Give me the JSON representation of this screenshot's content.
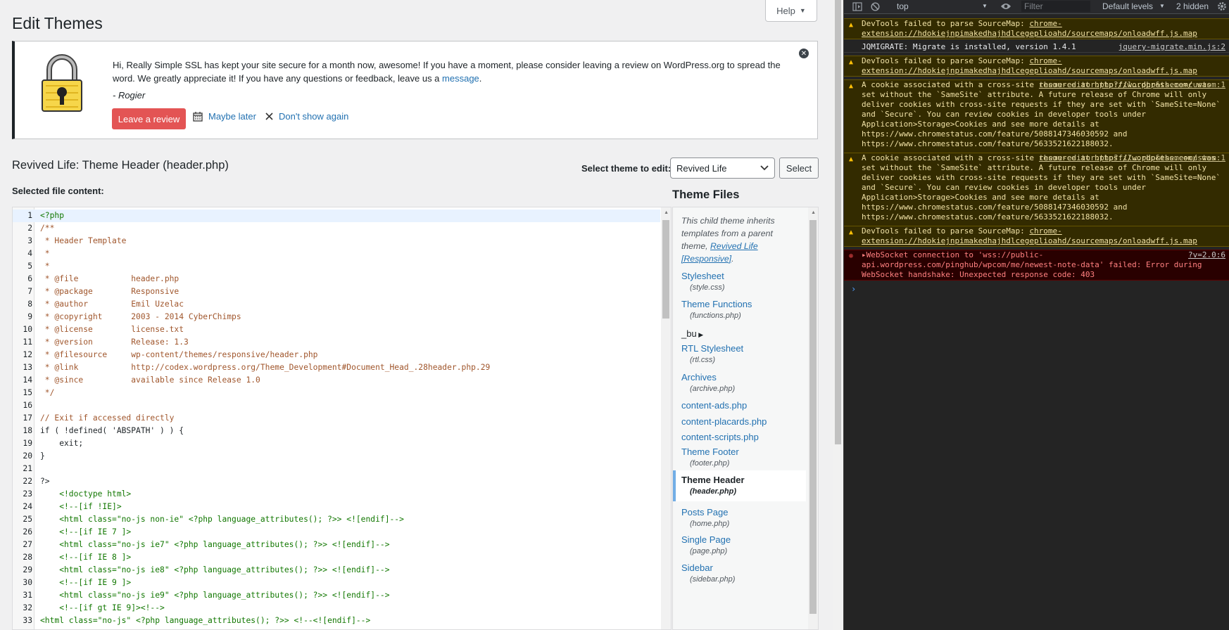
{
  "wp": {
    "help_label": "Help",
    "page_title": "Edit Themes",
    "notice": {
      "text_before": "Hi, Really Simple SSL has kept your site secure for a month now, awesome! If you have a moment, please consider leaving a review on WordPress.org to spread the word. We greatly appreciate it! If you have any questions or feedback, leave us a ",
      "link_message": "message",
      "text_after": ".",
      "signature": "- Rogier",
      "review_button": "Leave a review",
      "maybe_later": "Maybe later",
      "dont_show": "Don't show again"
    },
    "file_title": "Revived Life: Theme Header (header.php)",
    "select_label": "Select theme to edit:",
    "select_value": "Revived Life",
    "select_button": "Select",
    "content_label": "Selected file content:",
    "files_title": "Theme Files",
    "files_note_before": "This child theme inherits templates from a parent theme, ",
    "files_note_link": "Revived Life [Responsive]",
    "files_note_after": "."
  },
  "code_lines": [
    "<?php",
    "/**",
    " * Header Template",
    " *",
    " *",
    " * @file           header.php",
    " * @package        Responsive",
    " * @author         Emil Uzelac",
    " * @copyright      2003 - 2014 CyberChimps",
    " * @license        license.txt",
    " * @version        Release: 1.3",
    " * @filesource     wp-content/themes/responsive/header.php",
    " * @link           http://codex.wordpress.org/Theme_Development#Document_Head_.28header.php.29",
    " * @since          available since Release 1.0",
    " */",
    "",
    "// Exit if accessed directly",
    "if ( !defined( 'ABSPATH' ) ) {",
    "    exit;",
    "}",
    "",
    "?>",
    "    <!doctype html>",
    "    <!--[if !IE]>",
    "    <html class=\"no-js non-ie\" <?php language_attributes(); ?>> <![endif]-->",
    "    <!--[if IE 7 ]>",
    "    <html class=\"no-js ie7\" <?php language_attributes(); ?>> <![endif]-->",
    "    <!--[if IE 8 ]>",
    "    <html class=\"no-js ie8\" <?php language_attributes(); ?>> <![endif]-->",
    "    <!--[if IE 9 ]>",
    "    <html class=\"no-js ie9\" <?php language_attributes(); ?>> <![endif]-->",
    "    <!--[if gt IE 9]><!-->",
    "<html class=\"no-js\" <?php language_attributes(); ?>> <!--<![endif]-->"
  ],
  "files": [
    {
      "label": "Stylesheet",
      "sub": "(style.css)"
    },
    {
      "label": "Theme Functions",
      "sub": "(functions.php)"
    },
    {
      "label": "_bu",
      "folder": true
    },
    {
      "label": "RTL Stylesheet",
      "sub": "(rtl.css)"
    },
    {
      "label": "Archives",
      "sub": "(archive.php)"
    },
    {
      "label": "content-ads.php"
    },
    {
      "label": "content-placards.php"
    },
    {
      "label": "content-scripts.php"
    },
    {
      "label": "Theme Footer",
      "sub": "(footer.php)"
    },
    {
      "label": "Theme Header",
      "sub": "(header.php)",
      "active": true
    },
    {
      "label": "Posts Page",
      "sub": "(home.php)"
    },
    {
      "label": "Single Page",
      "sub": "(page.php)"
    },
    {
      "label": "Sidebar",
      "sub": "(sidebar.php)"
    }
  ],
  "devtools": {
    "context": "top",
    "filter_placeholder": "Filter",
    "levels": "Default levels",
    "hidden": "2 hidden",
    "messages": [
      {
        "level": "warn",
        "text": "DevTools failed to parse SourceMap: ",
        "link": "chrome-extension://hdokiejnpimakedhajhdlcegeplioahd/sourcemaps/onloadwff.js.map"
      },
      {
        "level": "info",
        "text": "JQMIGRATE: Migrate is installed, version 1.4.1",
        "source": "jquery-migrate.min.js:2"
      },
      {
        "level": "warn",
        "text": "DevTools failed to parse SourceMap: ",
        "link": "chrome-extension://hdokiejnpimakedhajhdlcegeplioahd/sourcemaps/onloadwff.js.map"
      },
      {
        "level": "warn",
        "text": "A cookie associated with a cross-site resource at http://wordpress.com/ was set without the `SameSite` attribute. A future release of Chrome will only deliver cookies with cross-site requests if they are set with `SameSite=None` and `Secure`. You can review cookies in developer tools under Application>Storage>Cookies and see more details at https://www.chromestatus.com/feature/5088147346030592 and https://www.chromestatus.com/feature/5633521622188032.",
        "source": "theme-editor.php?fil….php&theme=custom:1"
      },
      {
        "level": "warn",
        "text": "A cookie associated with a cross-site resource at https://wordpress.com/ was set without the `SameSite` attribute. A future release of Chrome will only deliver cookies with cross-site requests if they are set with `SameSite=None` and `Secure`. You can review cookies in developer tools under Application>Storage>Cookies and see more details at https://www.chromestatus.com/feature/5088147346030592 and https://www.chromestatus.com/feature/5633521622188032.",
        "source": "theme-editor.php?fil….php&theme=custom:1"
      },
      {
        "level": "warn",
        "text": "DevTools failed to parse SourceMap: ",
        "link": "chrome-extension://hdokiejnpimakedhajhdlcegeplioahd/sourcemaps/onloadwff.js.map"
      },
      {
        "level": "error",
        "text": "▸WebSocket connection to 'wss://public-api.wordpress.com/pinghub/wpcom/me/newest-note-data' failed: Error during WebSocket handshake: Unexpected response code: 403",
        "source": "?v=2.0:6"
      }
    ]
  }
}
